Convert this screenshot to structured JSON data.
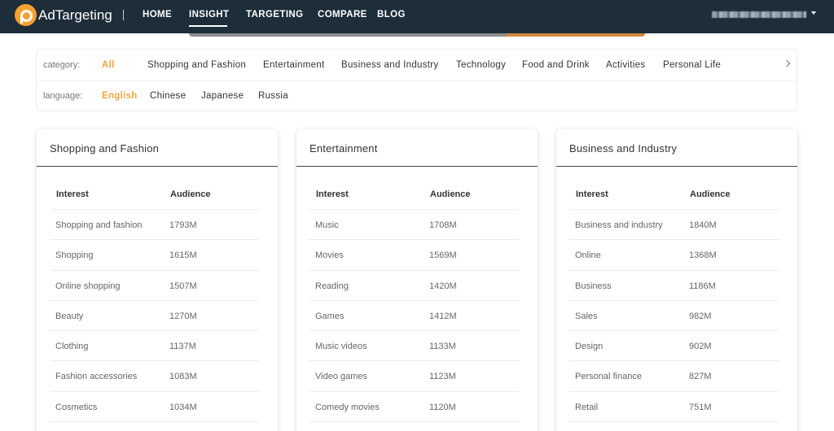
{
  "header": {
    "brand": "AdTargeting",
    "nav": [
      "HOME",
      "INSIGHT",
      "TARGETING",
      "COMPARE",
      "BLOG"
    ],
    "active_nav": "INSIGHT"
  },
  "filters": {
    "category_label": "category:",
    "categories": [
      "All",
      "Shopping and Fashion",
      "Entertainment",
      "Business and Industry",
      "Technology",
      "Food and Drink",
      "Activities",
      "Personal Life"
    ],
    "category_active": "All",
    "language_label": "language:",
    "languages": [
      "English",
      "Chinese",
      "Japanese",
      "Russia"
    ],
    "language_active": "English"
  },
  "cards": [
    {
      "title": "Shopping and Fashion",
      "col_interest": "Interest",
      "col_audience": "Audience",
      "rows": [
        [
          "Shopping and fashion",
          "1793M"
        ],
        [
          "Shopping",
          "1615M"
        ],
        [
          "Online shopping",
          "1507M"
        ],
        [
          "Beauty",
          "1270M"
        ],
        [
          "Clothing",
          "1137M"
        ],
        [
          "Fashion accessories",
          "1083M"
        ],
        [
          "Cosmetics",
          "1034M"
        ]
      ]
    },
    {
      "title": "Entertainment",
      "col_interest": "Interest",
      "col_audience": "Audience",
      "rows": [
        [
          "Music",
          "1708M"
        ],
        [
          "Movies",
          "1569M"
        ],
        [
          "Reading",
          "1420M"
        ],
        [
          "Games",
          "1412M"
        ],
        [
          "Music videos",
          "1133M"
        ],
        [
          "Video games",
          "1123M"
        ],
        [
          "Comedy movies",
          "1120M"
        ]
      ]
    },
    {
      "title": "Business and Industry",
      "col_interest": "Interest",
      "col_audience": "Audience",
      "rows": [
        [
          "Business and industry",
          "1840M"
        ],
        [
          "Online",
          "1368M"
        ],
        [
          "Business",
          "1186M"
        ],
        [
          "Sales",
          "982M"
        ],
        [
          "Design",
          "902M"
        ],
        [
          "Personal finance",
          "827M"
        ],
        [
          "Retail",
          "751M"
        ]
      ]
    }
  ],
  "colors": {
    "nav_bg": "#1d2d3a",
    "accent": "#f0a540"
  }
}
